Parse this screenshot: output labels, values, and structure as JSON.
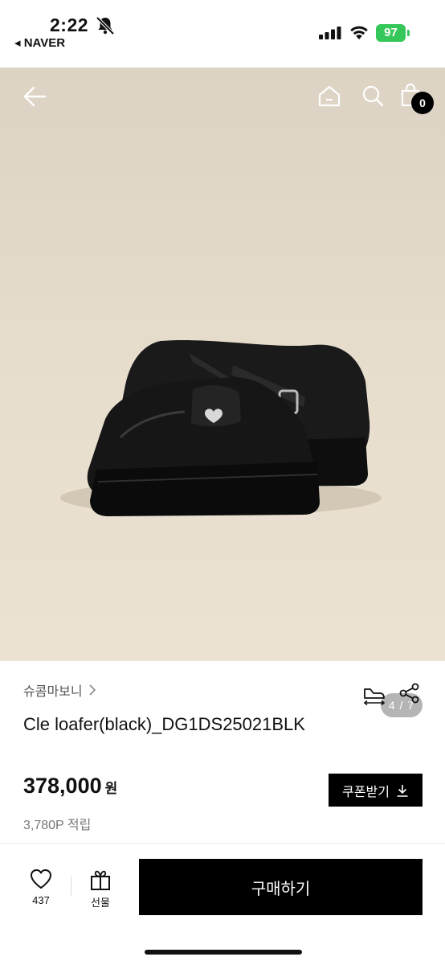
{
  "status_bar": {
    "time": "2:22",
    "back_app": "◂ NAVER",
    "battery": "97"
  },
  "hero": {
    "pager": "4 / 7",
    "cart_count": "0"
  },
  "product": {
    "brand": "슈콤마보니",
    "title": "Cle loafer(black)_DG1DS25021BLK",
    "price": "378,000",
    "currency": "원",
    "points": "3,780P 적립",
    "coupon_label": "쿠폰받기"
  },
  "bottom_bar": {
    "likes": "437",
    "gift_label": "선물",
    "buy_label": "구매하기"
  },
  "colors": {
    "accent": "#000000",
    "battery": "#35c759",
    "hero_bg": "#e6dccc"
  },
  "icons": [
    "bell-slash-icon",
    "signal-icon",
    "wifi-icon",
    "battery-icon",
    "back-arrow-icon",
    "home-icon",
    "search-icon",
    "bag-icon",
    "chevron-right-icon",
    "size-ruler-icon",
    "share-icon",
    "download-icon",
    "heart-icon",
    "gift-icon"
  ]
}
